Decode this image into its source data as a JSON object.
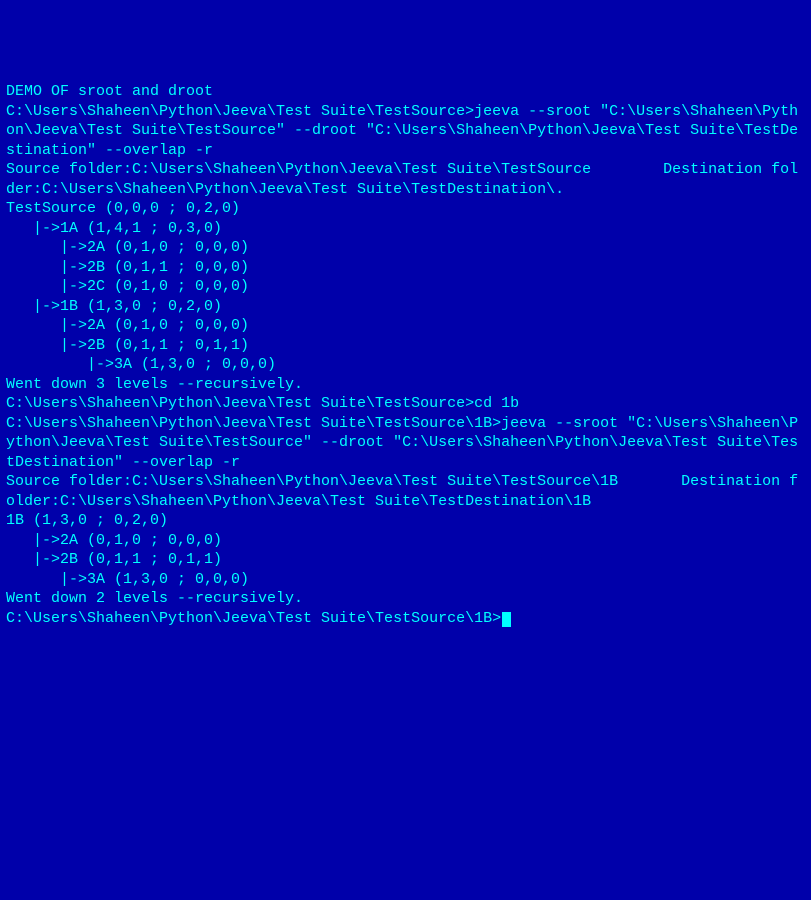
{
  "terminal": {
    "lines": [
      "DEMO OF sroot and droot",
      "",
      "C:\\Users\\Shaheen\\Python\\Jeeva\\Test Suite\\TestSource>jeeva --sroot \"C:\\Users\\Shaheen\\Python\\Jeeva\\Test Suite\\TestSource\" --droot \"C:\\Users\\Shaheen\\Python\\Jeeva\\Test Suite\\TestDestination\" --overlap -r",
      "Source folder:C:\\Users\\Shaheen\\Python\\Jeeva\\Test Suite\\TestSource        Destination folder:C:\\Users\\Shaheen\\Python\\Jeeva\\Test Suite\\TestDestination\\.",
      "TestSource (0,0,0 ; 0,2,0)",
      "   |->1A (1,4,1 ; 0,3,0)",
      "      |->2A (0,1,0 ; 0,0,0)",
      "      |->2B (0,1,1 ; 0,0,0)",
      "      |->2C (0,1,0 ; 0,0,0)",
      "   |->1B (1,3,0 ; 0,2,0)",
      "      |->2A (0,1,0 ; 0,0,0)",
      "      |->2B (0,1,1 ; 0,1,1)",
      "         |->3A (1,3,0 ; 0,0,0)",
      "",
      "",
      "Went down 3 levels --recursively.",
      "C:\\Users\\Shaheen\\Python\\Jeeva\\Test Suite\\TestSource>cd 1b",
      "",
      "C:\\Users\\Shaheen\\Python\\Jeeva\\Test Suite\\TestSource\\1B>jeeva --sroot \"C:\\Users\\Shaheen\\Python\\Jeeva\\Test Suite\\TestSource\" --droot \"C:\\Users\\Shaheen\\Python\\Jeeva\\Test Suite\\TestDestination\" --overlap -r",
      "Source folder:C:\\Users\\Shaheen\\Python\\Jeeva\\Test Suite\\TestSource\\1B       Destination folder:C:\\Users\\Shaheen\\Python\\Jeeva\\Test Suite\\TestDestination\\1B",
      "1B (1,3,0 ; 0,2,0)",
      "   |->2A (0,1,0 ; 0,0,0)",
      "   |->2B (0,1,1 ; 0,1,1)",
      "      |->3A (1,3,0 ; 0,0,0)",
      "",
      "",
      "Went down 2 levels --recursively.",
      "C:\\Users\\Shaheen\\Python\\Jeeva\\Test Suite\\TestSource\\1B>"
    ]
  }
}
